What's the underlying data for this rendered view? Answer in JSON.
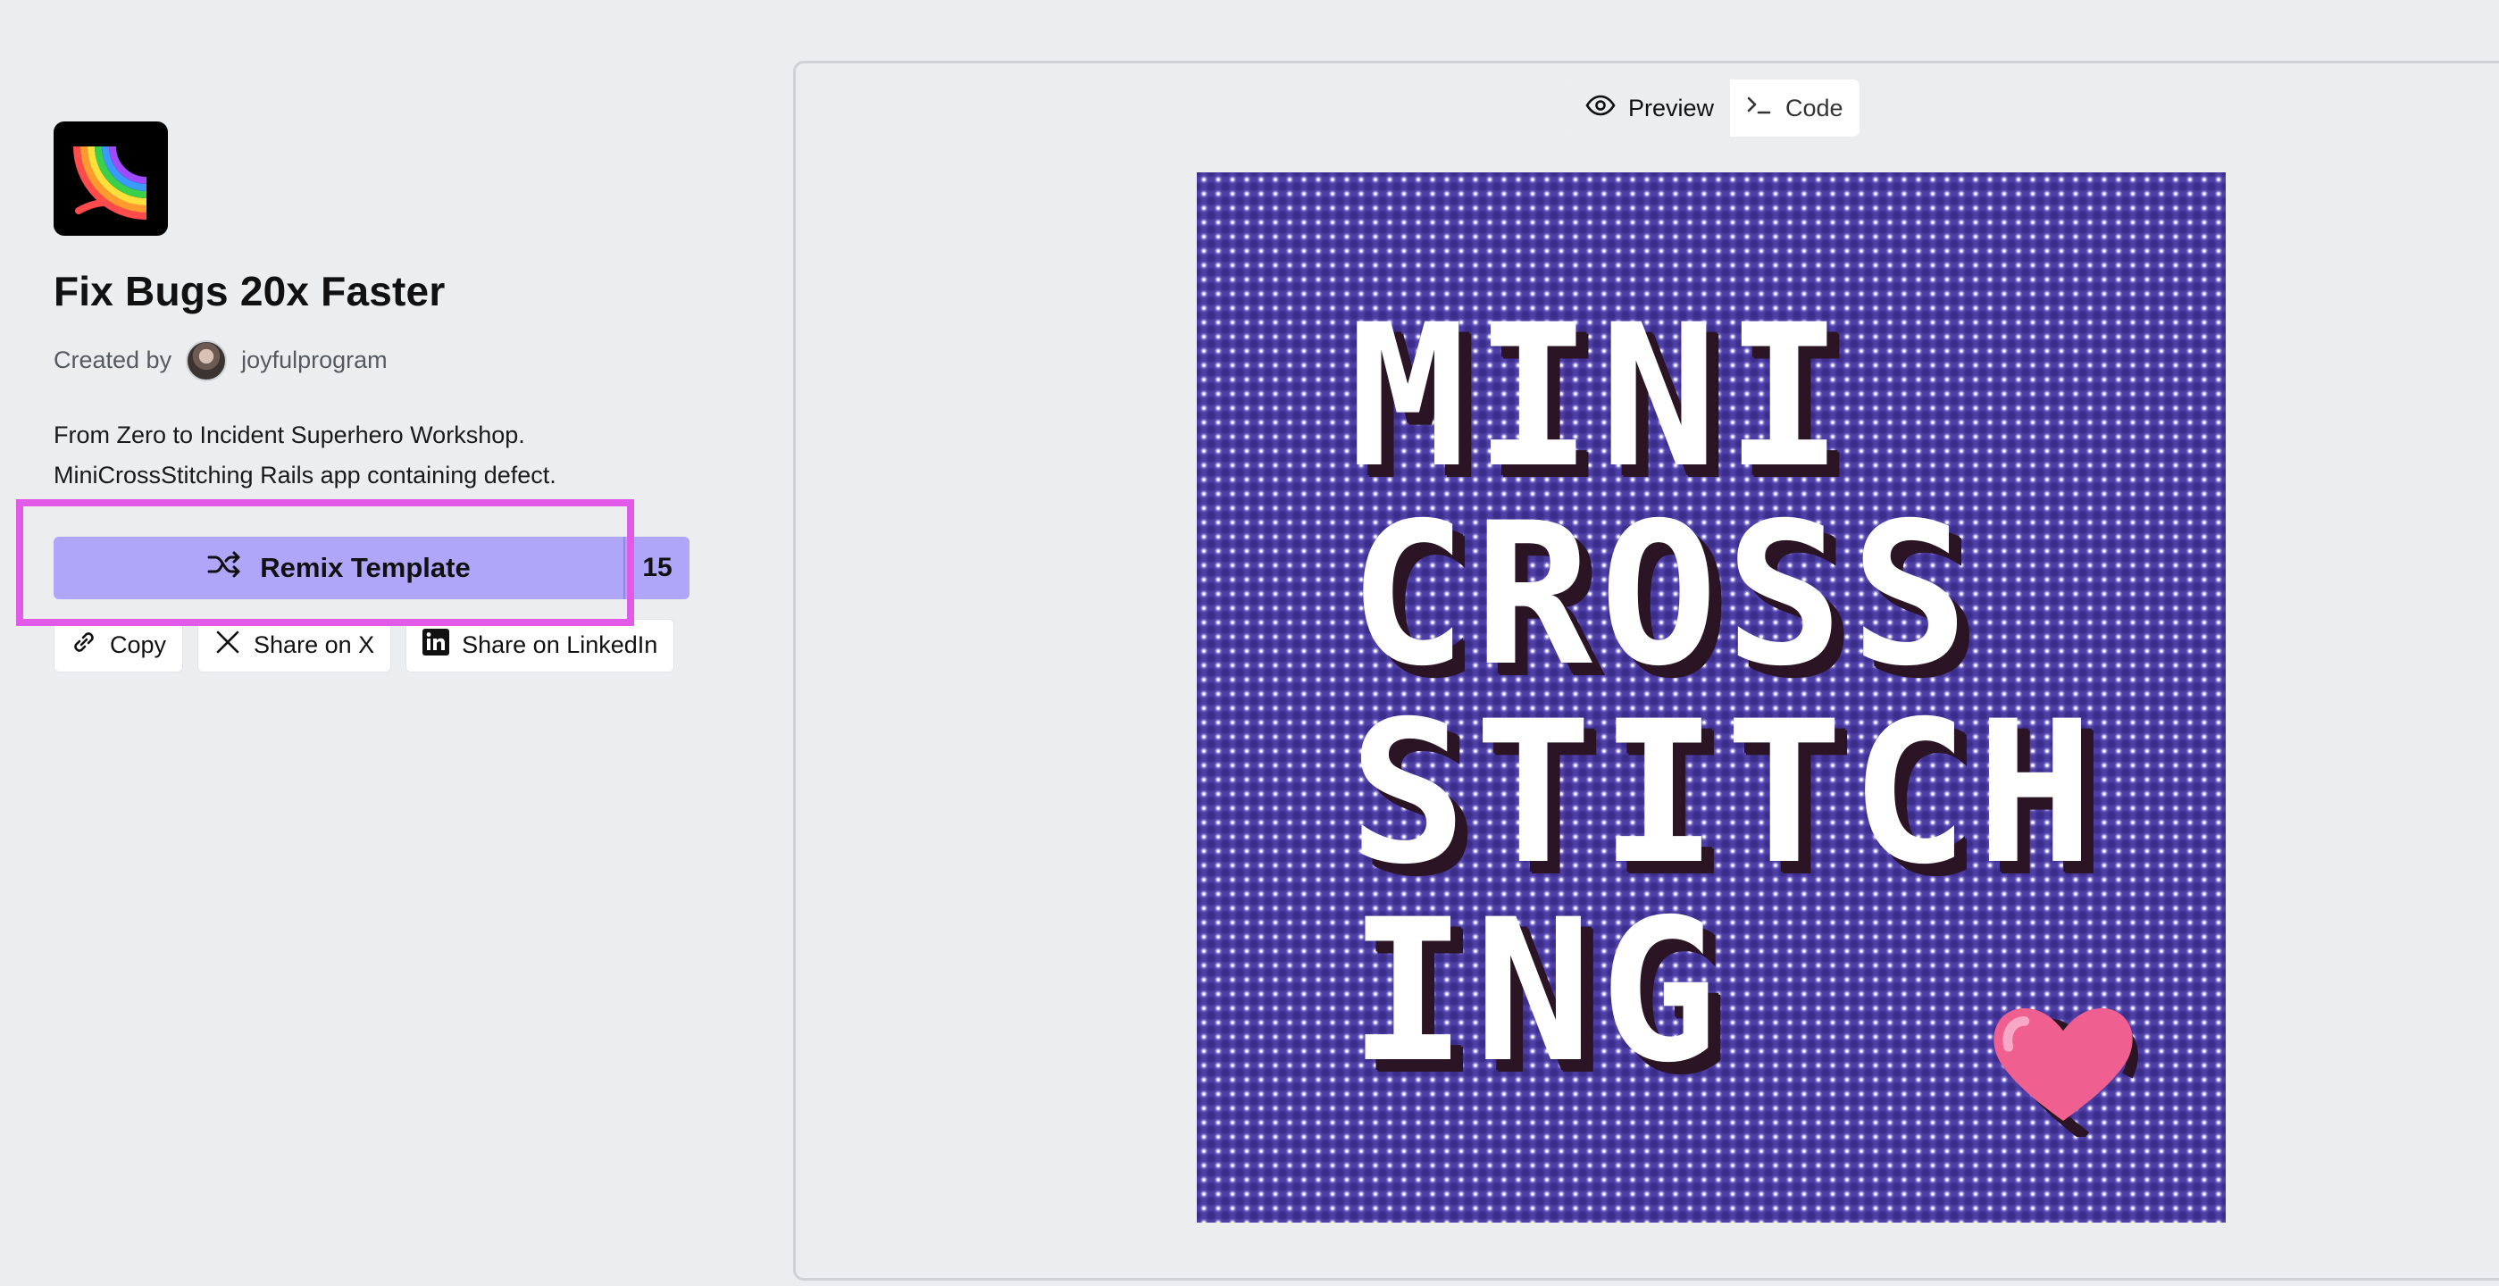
{
  "template": {
    "title": "Fix Bugs 20x Faster",
    "created_by_label": "Created by",
    "author": "joyfulprogram",
    "description_line1": "From Zero to Incident Superhero Workshop.",
    "description_line2": "MiniCrossStitching Rails app containing defect."
  },
  "actions": {
    "remix_label": "Remix Template",
    "remix_count": "15",
    "copy_label": "Copy",
    "share_x_label": "Share on X",
    "share_linkedin_label": "Share on LinkedIn"
  },
  "preview": {
    "tabs": [
      {
        "label": "Preview",
        "icon": "eye-icon",
        "active": true
      },
      {
        "label": "Code",
        "icon": "terminal-icon",
        "active": false
      }
    ],
    "image_text": [
      "MINI",
      "CROSS",
      "STITCH",
      "ING"
    ]
  },
  "colors": {
    "accent": "#afa6fa",
    "highlight": "#e45ae8",
    "canvas": "#4e3fa6",
    "heart": "#f06292"
  }
}
